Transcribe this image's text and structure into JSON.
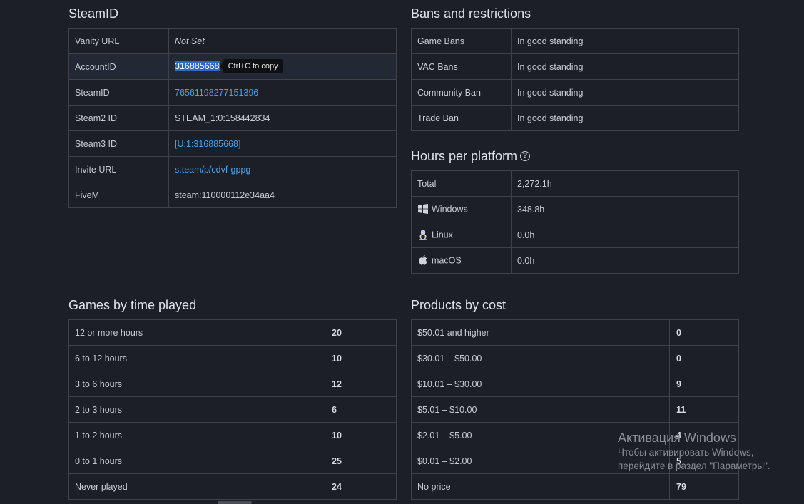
{
  "steamid": {
    "title": "SteamID",
    "rows": [
      {
        "label": "Vanity URL",
        "value": "Not Set"
      },
      {
        "label": "AccountID",
        "value": "316885668"
      },
      {
        "label": "SteamID",
        "value": "76561198277151396"
      },
      {
        "label": "Steam2 ID",
        "value": "STEAM_1:0:158442834"
      },
      {
        "label": "Steam3 ID",
        "value": "[U:1:316885668]"
      },
      {
        "label": "Invite URL",
        "value": "s.team/p/cdvf-gppg"
      },
      {
        "label": "FiveM",
        "value": "steam:110000112e34aa4"
      }
    ],
    "tooltip": "Ctrl+C to copy"
  },
  "bans": {
    "title": "Bans and restrictions",
    "rows": [
      {
        "label": "Game Bans",
        "value": "In good standing"
      },
      {
        "label": "VAC Bans",
        "value": "In good standing"
      },
      {
        "label": "Community Ban",
        "value": "In good standing"
      },
      {
        "label": "Trade Ban",
        "value": "In good standing"
      }
    ]
  },
  "hours": {
    "title": "Hours per platform",
    "help_icon": "?",
    "rows": [
      {
        "label": "Total",
        "value": "2,272.1h",
        "icon": ""
      },
      {
        "label": "Windows",
        "value": "348.8h",
        "icon": "windows-icon"
      },
      {
        "label": "Linux",
        "value": "0.0h",
        "icon": "linux-icon"
      },
      {
        "label": "macOS",
        "value": "0.0h",
        "icon": "apple-icon"
      }
    ]
  },
  "games": {
    "title": "Games by time played",
    "rows": [
      {
        "label": "12 or more hours",
        "value": "20"
      },
      {
        "label": "6 to 12 hours",
        "value": "10"
      },
      {
        "label": "3 to 6 hours",
        "value": "12"
      },
      {
        "label": "2 to 3 hours",
        "value": "6"
      },
      {
        "label": "1 to 2 hours",
        "value": "10"
      },
      {
        "label": "0 to 1 hours",
        "value": "25"
      },
      {
        "label": "Never played",
        "value": "24"
      }
    ]
  },
  "products": {
    "title": "Products by cost",
    "rows": [
      {
        "label": "$50.01 and higher",
        "value": "0"
      },
      {
        "label": "$30.01 – $50.00",
        "value": "0"
      },
      {
        "label": "$10.01 – $30.00",
        "value": "9"
      },
      {
        "label": "$5.01 – $10.00",
        "value": "11"
      },
      {
        "label": "$2.01 – $5.00",
        "value": "4"
      },
      {
        "label": "$0.01 – $2.00",
        "value": "5"
      },
      {
        "label": "No price",
        "value": "79"
      }
    ]
  },
  "watermark": {
    "title": "Активация Windows",
    "line1": "Чтобы активировать Windows,",
    "line2": "перейдите в раздел \"Параметры\"."
  }
}
